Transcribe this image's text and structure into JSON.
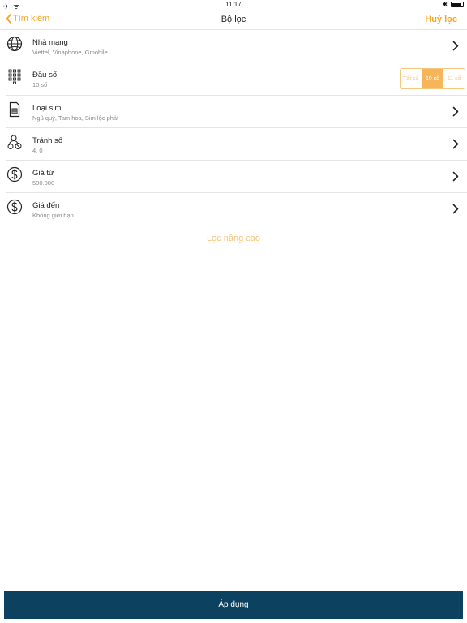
{
  "status_bar": {
    "time": "11:17"
  },
  "nav": {
    "back_label": "Tìm kiếm",
    "title": "Bộ lọc",
    "cancel_label": "Huỷ lọc"
  },
  "filters": [
    {
      "title": "Nhà mạng",
      "subtitle": "Viettel, Vinaphone, Gmobile",
      "icon": "globe-icon"
    },
    {
      "title": "Đầu số",
      "subtitle": "10 số",
      "icon": "keypad-icon",
      "options": [
        "Tất cả",
        "10 số",
        "11 số"
      ],
      "selected": "10 số"
    },
    {
      "title": "Loại sim",
      "subtitle": "Ngũ quý, Tam hoa, Sim lộc phát",
      "icon": "sim-card-icon"
    },
    {
      "title": "Tránh số",
      "subtitle": "4, 0",
      "icon": "avoid-numbers-icon"
    },
    {
      "title": "Giá từ",
      "subtitle": "500.000",
      "icon": "dollar-icon"
    },
    {
      "title": "Giá đến",
      "subtitle": "Không giới hạn",
      "icon": "dollar-icon"
    }
  ],
  "advanced_label": "Lọc nâng cao",
  "apply_label": "Áp dụng",
  "colors": {
    "accent": "#f5a623",
    "apply_bg": "#0d4160",
    "segment_active": "#f7b55a"
  }
}
